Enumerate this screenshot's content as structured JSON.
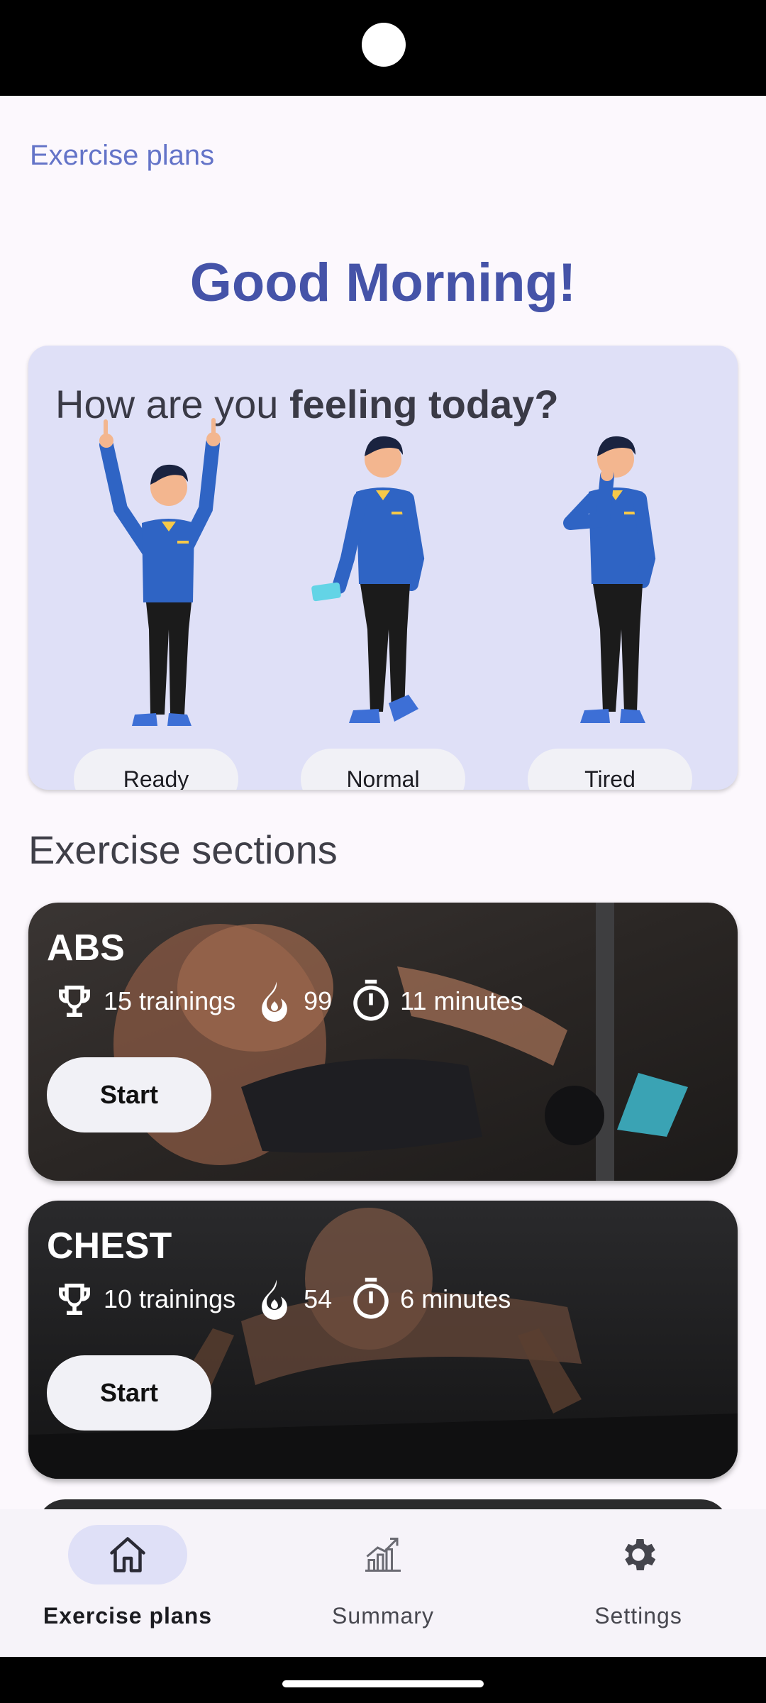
{
  "header": {
    "title": "Exercise plans"
  },
  "greeting": "Good Morning!",
  "mood": {
    "question_prefix": "How are you ",
    "question_bold": "feeling today?",
    "options": [
      {
        "label": "Ready"
      },
      {
        "label": "Normal"
      },
      {
        "label": "Tired"
      }
    ]
  },
  "sections": {
    "title": "Exercise sections",
    "items": [
      {
        "name": "ABS",
        "trainings": "15 trainings",
        "calories": "99",
        "duration": "11 minutes",
        "start_label": "Start"
      },
      {
        "name": "CHEST",
        "trainings": "10 trainings",
        "calories": "54",
        "duration": "6 minutes",
        "start_label": "Start"
      }
    ]
  },
  "nav": {
    "items": [
      {
        "label": "Exercise plans",
        "icon": "home-icon",
        "active": true
      },
      {
        "label": "Summary",
        "icon": "chart-icon",
        "active": false
      },
      {
        "label": "Settings",
        "icon": "gear-icon",
        "active": false
      }
    ]
  },
  "colors": {
    "accent": "#4553a8",
    "title": "#6474c8",
    "card_bg": "#dfe0f7",
    "screen_bg": "#fcf8fd"
  }
}
